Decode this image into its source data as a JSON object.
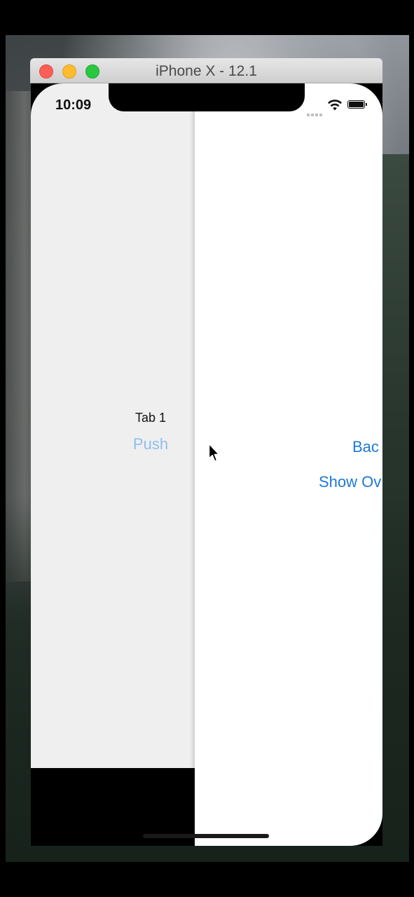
{
  "window": {
    "title": "iPhone X - 12.1"
  },
  "status_bar": {
    "time": "10:09"
  },
  "left_screen": {
    "label": "Tab 1",
    "push_label": "Push"
  },
  "right_screen": {
    "back_label": "Bac",
    "overlay_label": "Show Ov"
  },
  "colors": {
    "link_blue": "#1c7ad8",
    "link_blue_faded": "#8ebff0",
    "left_background": "#efefef"
  }
}
